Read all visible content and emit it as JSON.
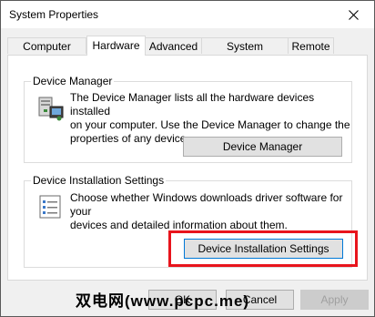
{
  "window": {
    "title": "System Properties"
  },
  "tabs": [
    {
      "label": "Computer Name"
    },
    {
      "label": "Hardware"
    },
    {
      "label": "Advanced"
    },
    {
      "label": "System Protection"
    },
    {
      "label": "Remote"
    }
  ],
  "device_manager": {
    "group_title": "Device Manager",
    "description_line1": "The Device Manager lists all the hardware devices installed",
    "description_line2": "on your computer. Use the Device Manager to change the",
    "description_line3": "properties of any device.",
    "button_label": "Device Manager"
  },
  "device_installation": {
    "group_title": "Device Installation Settings",
    "description_line1": "Choose whether Windows downloads driver software for your",
    "description_line2": "devices and detailed information about them.",
    "button_label": "Device Installation Settings"
  },
  "footer": {
    "ok_label": "OK",
    "cancel_label": "Cancel",
    "apply_label": "Apply"
  },
  "watermark": {
    "text": "双电网(www.pcpc.me)"
  },
  "colors": {
    "highlight": "#e8141c",
    "focus": "#0078d7"
  },
  "icons": {
    "close": "close-icon",
    "device_manager": "device-manager-icon",
    "settings_list": "settings-list-icon"
  }
}
